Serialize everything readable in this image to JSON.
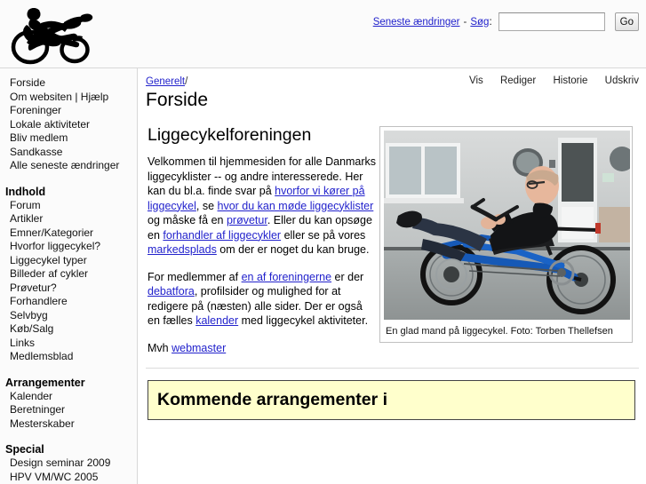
{
  "site": {
    "logo_alt": "recumbent-bicycle-logo"
  },
  "header": {
    "recent_changes_label": "Seneste ændringer",
    "separator": "-",
    "search_label": "Søg",
    "search_colon": ":",
    "search_value": "",
    "search_placeholder": "",
    "go_label": "Go"
  },
  "sidebar": {
    "top_links": [
      {
        "label": "Forside"
      },
      {
        "label": "Om websiten | Hjælp"
      },
      {
        "label": "Foreninger"
      },
      {
        "label": "Lokale aktiviteter"
      },
      {
        "label": "Bliv medlem"
      },
      {
        "label": "Sandkasse"
      },
      {
        "label": "Alle seneste ændringer"
      }
    ],
    "sections": [
      {
        "heading": "Indhold",
        "links": [
          {
            "label": "Forum"
          },
          {
            "label": "Artikler"
          },
          {
            "label": "Emner/Kategorier"
          },
          {
            "label": "Hvorfor liggecykel?"
          },
          {
            "label": "Liggecykel typer"
          },
          {
            "label": "Billeder af cykler"
          },
          {
            "label": "Prøvetur?"
          },
          {
            "label": "Forhandlere"
          },
          {
            "label": "Selvbyg"
          },
          {
            "label": "Køb/Salg"
          },
          {
            "label": "Links"
          },
          {
            "label": "Medlemsblad"
          }
        ]
      },
      {
        "heading": "Arrangementer",
        "links": [
          {
            "label": "Kalender"
          },
          {
            "label": "Beretninger"
          },
          {
            "label": "Mesterskaber"
          }
        ]
      },
      {
        "heading": "Special",
        "links": [
          {
            "label": "Design seminar 2009"
          },
          {
            "label": "HPV VM/WC 2005"
          }
        ]
      }
    ]
  },
  "page_actions": [
    {
      "label": "Vis"
    },
    {
      "label": "Rediger"
    },
    {
      "label": "Historie"
    },
    {
      "label": "Udskriv"
    }
  ],
  "breadcrumb": {
    "parent": "Generelt",
    "trailing": "/"
  },
  "page": {
    "title": "Forside",
    "article_heading": "Liggecykelforeningen"
  },
  "article": {
    "p1": {
      "t1": "Velkommen til hjemmesiden for alle Danmarks liggecyklister -- og andre interesserede. Her kan du bl.a. finde svar på ",
      "link1": "hvorfor vi kører på liggecykel",
      "t2": ", se ",
      "link2": "hvor du kan møde liggecyklister",
      "t3": " og måske få en ",
      "link3": "prøvetur",
      "t4": ". Eller du kan opsøge en ",
      "link4": "forhandler af liggecykler",
      "t5": " eller se på vores ",
      "link5": "markedsplads",
      "t6": " om der er noget du kan bruge."
    },
    "p2": {
      "t1": "For medlemmer af ",
      "link1": "en af foreningerne",
      "t2": " er der ",
      "link2": "debatfora",
      "t3": ", profilsider og mulighed for at redigere på (næsten) alle sider. Der er også en fælles ",
      "link3": "kalender",
      "t4": " med liggecykel aktiviteter."
    },
    "p3": {
      "t1": "Mvh ",
      "link1": "webmaster"
    }
  },
  "figure": {
    "photo_alt": "man-riding-blue-recumbent-bicycle",
    "caption": "En glad mand på liggecykel. Foto: Torben Thellefsen"
  },
  "events": {
    "heading": "Kommende arrangementer i"
  },
  "colors": {
    "link": "#2222cc",
    "page_bg": "#ffffff",
    "chrome_bg": "#fbfbfb",
    "border": "#d8d8d8",
    "events_bg": "#ffffcc",
    "events_border": "#444444"
  }
}
